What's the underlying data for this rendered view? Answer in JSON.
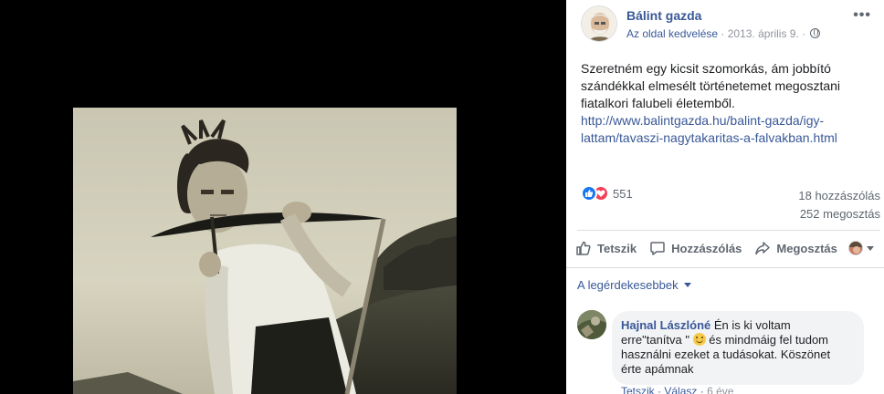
{
  "post": {
    "page_name": "Bálint gazda",
    "like_page": "Az oldal kedvelése",
    "separator": " · ",
    "date": "2013. április 9.",
    "date_suffix": " · ",
    "text": "Szeretném egy kicsit szomorkás, ám jobbító szándékkal elmesélt történetemet megosztani fiatalkori falubeli életemből.",
    "link": "http://www.balintgazda.hu/balint-gazda/igy-lattam/tavaszi-nagytakaritas-a-falvakban.html",
    "more_icon": "more-dots-icon",
    "privacy_icon": "globe-icon"
  },
  "stats": {
    "reaction_count": "551",
    "comments": "18 hozzászólás",
    "shares": "252 megosztás",
    "reaction_icons": [
      "like-icon",
      "love-icon"
    ]
  },
  "actions": {
    "like": "Tetszik",
    "comment": "Hozzászólás",
    "share": "Megosztás"
  },
  "sort": {
    "label": "A legérdekesebbek"
  },
  "comment": {
    "author": "Hajnal Lászlóné",
    "text_before": " Én is ki voltam erre\"tanítva \" ",
    "text_after": " és mindmáig fel tudom használni ezeket a tudásokat. Köszönet érte apámnak",
    "like": "Tetszik",
    "dot": " · ",
    "reply": "Válasz",
    "time": "6 éve"
  },
  "colors": {
    "link": "#385898",
    "meta": "#90949c",
    "like_blue": "#1877f2",
    "love_red": "#f33e58",
    "bubble": "#f2f3f5"
  }
}
